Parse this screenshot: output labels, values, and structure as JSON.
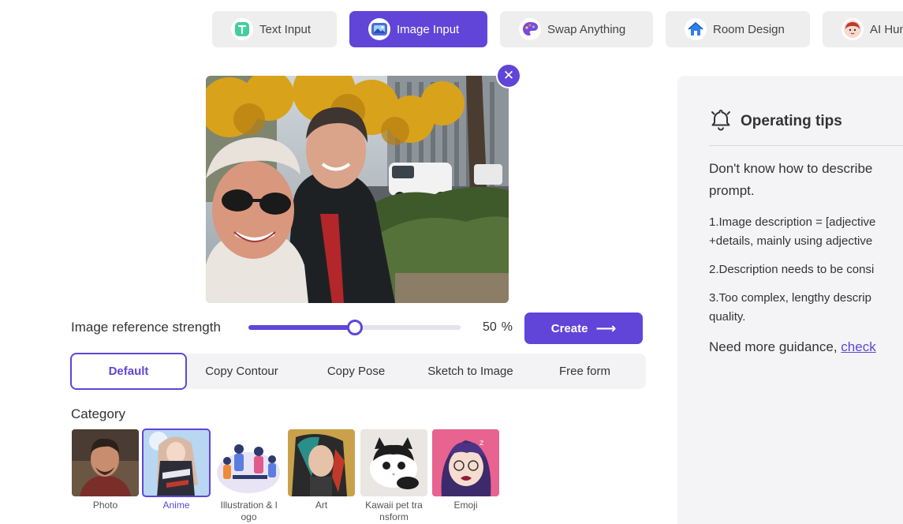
{
  "tabs": [
    {
      "label": "Text Input",
      "icon": "text-t-icon",
      "active": false
    },
    {
      "label": "Image Input",
      "icon": "image-icon",
      "active": true
    },
    {
      "label": "Swap Anything",
      "icon": "palette-icon",
      "active": false
    },
    {
      "label": "Room Design",
      "icon": "house-icon",
      "active": false
    },
    {
      "label": "AI Hun",
      "icon": "avatar-icon",
      "active": false
    }
  ],
  "upload": {
    "close_symbol": "✕"
  },
  "strength": {
    "label": "Image reference strength",
    "value": 50,
    "value_number": "50",
    "unit": "%"
  },
  "create": {
    "label": "Create",
    "arrow": "⟶"
  },
  "modes": [
    {
      "label": "Default",
      "active": true
    },
    {
      "label": "Copy Contour",
      "active": false
    },
    {
      "label": "Copy Pose",
      "active": false
    },
    {
      "label": "Sketch to Image",
      "active": false
    },
    {
      "label": "Free form",
      "active": false
    }
  ],
  "category": {
    "title": "Category",
    "items": [
      {
        "label": "Photo",
        "active": false
      },
      {
        "label": "Anime",
        "active": true
      },
      {
        "label": "Illustration & l\nogo",
        "active": false
      },
      {
        "label": "Art",
        "active": false
      },
      {
        "label": "Kawaii pet tra\nnsform",
        "active": false
      },
      {
        "label": "Emoji",
        "active": false
      }
    ]
  },
  "tips": {
    "title": "Operating tips",
    "lead_1": "Don't know how to describe",
    "lead_2": "prompt.",
    "item_1a": "1.Image description = [adjective",
    "item_1b": "+details, mainly using adjective",
    "item_2": "2.Description needs to be consi",
    "item_3a": "3.Too complex, lengthy descrip",
    "item_3b": "quality.",
    "guide_text": "Need more guidance, ",
    "guide_link": "check"
  },
  "colors": {
    "accent": "#6045d8",
    "tab_bg": "#eeeeef",
    "panel_bg": "#f4f4f6"
  }
}
